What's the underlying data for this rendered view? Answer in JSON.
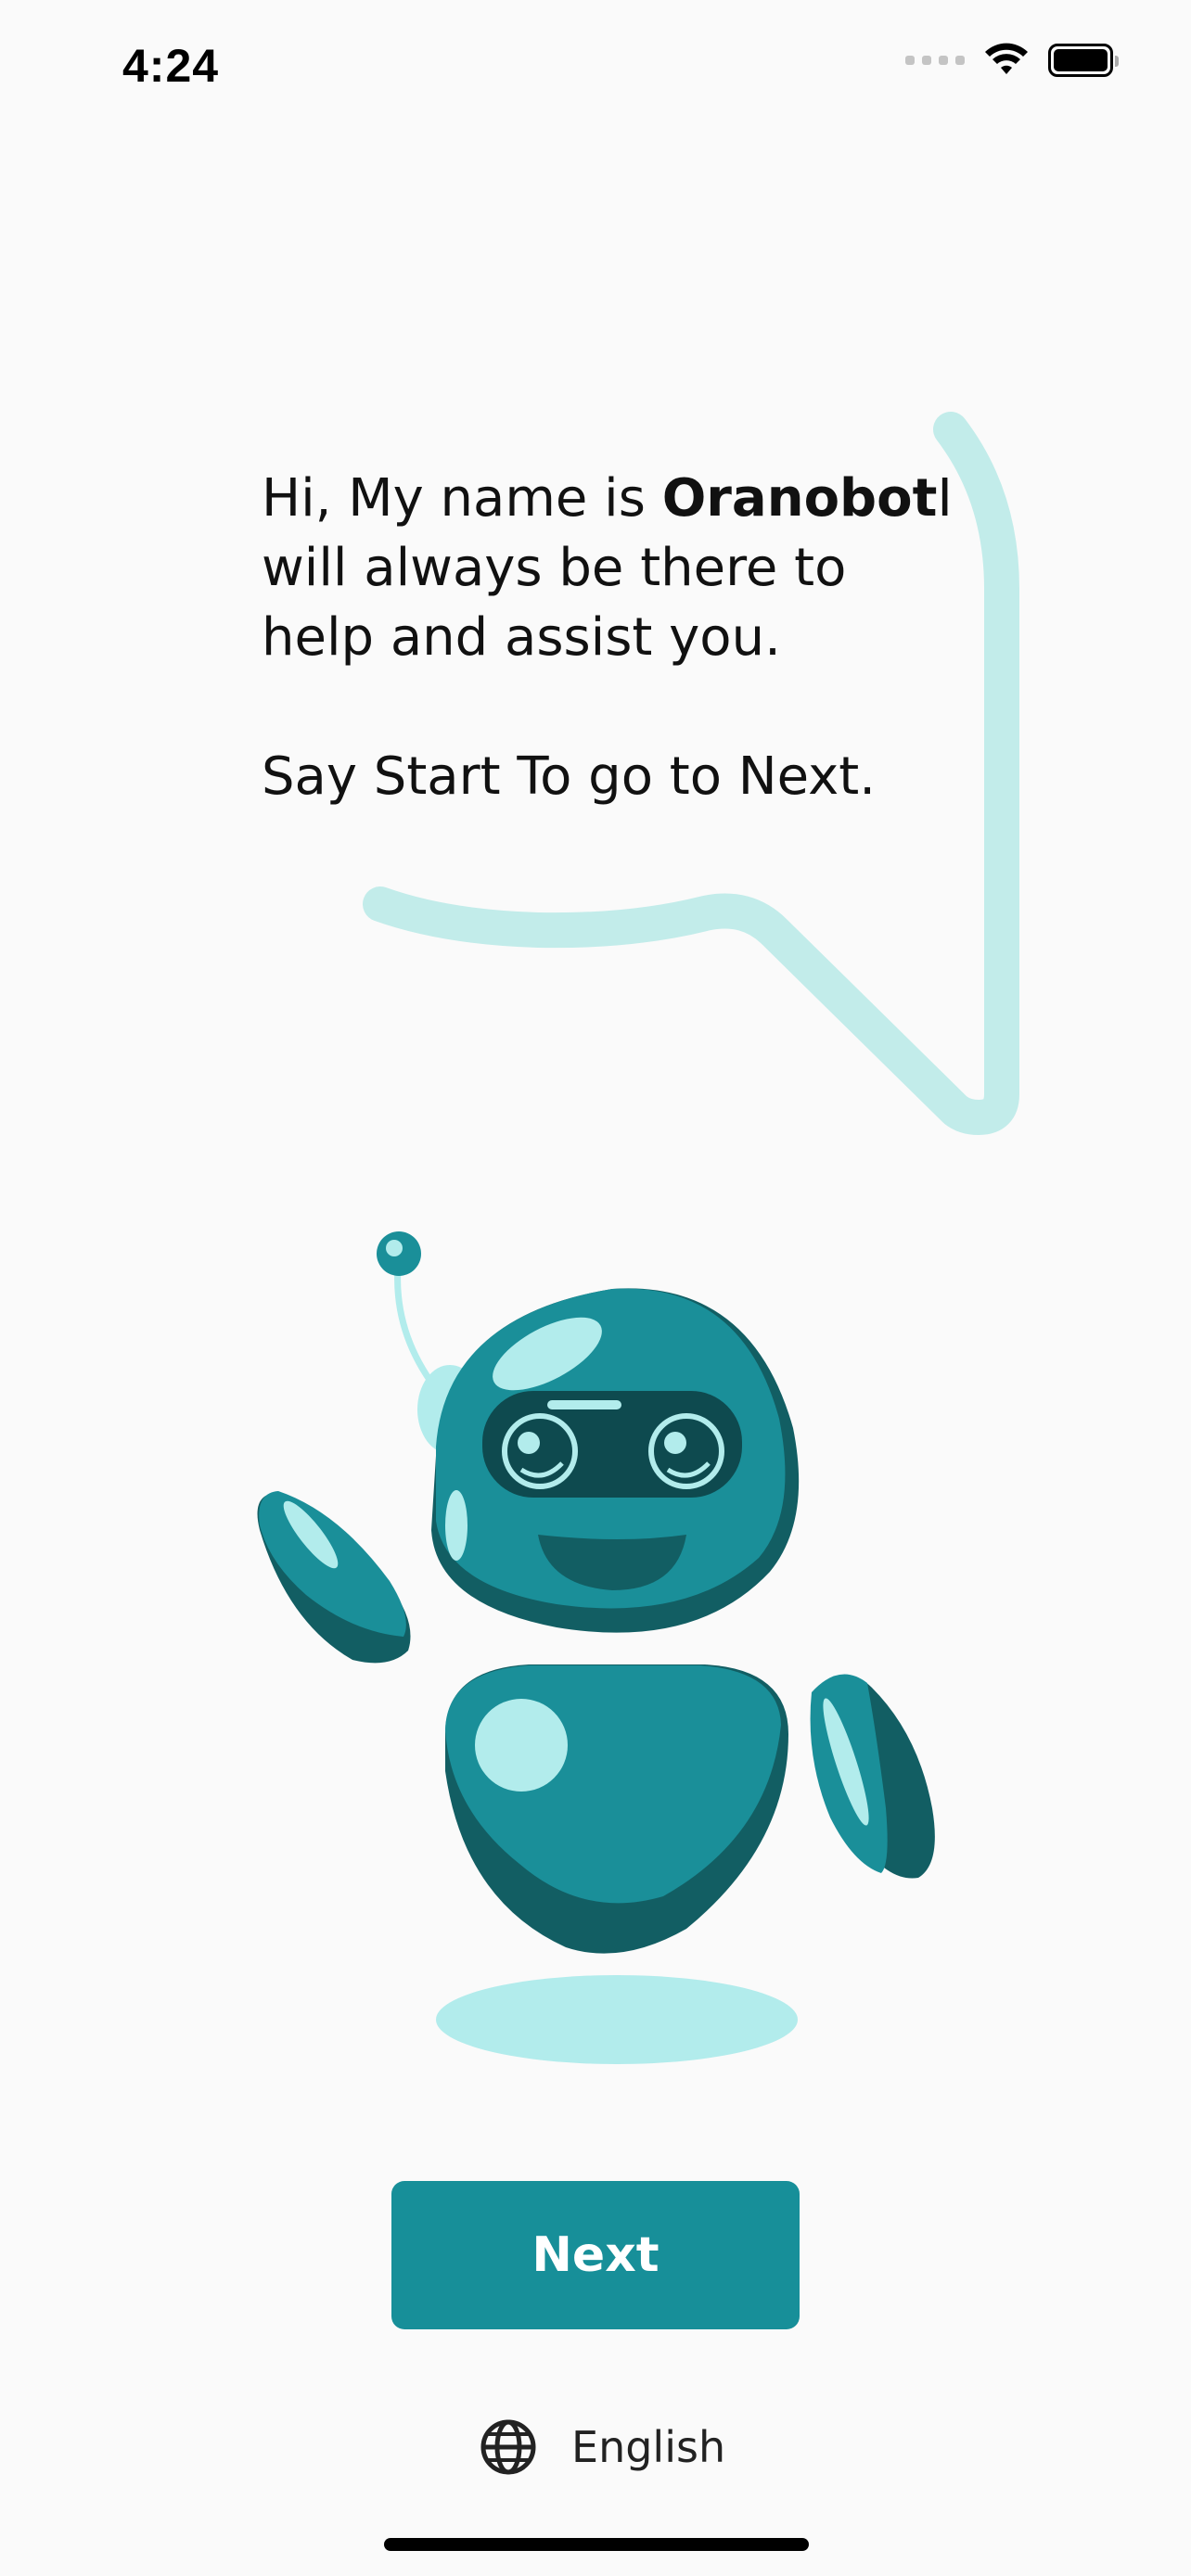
{
  "status_bar": {
    "time": "4:24"
  },
  "greeting": {
    "line1_prefix": "Hi, My name is ",
    "bot_name": "Oranobot",
    "line1_suffix": "I",
    "line2": "will always be there to",
    "line3": "help and assist you.",
    "line4": "Say Start To go to Next."
  },
  "actions": {
    "next_label": "Next"
  },
  "language": {
    "icon": "globe-icon",
    "label": "English"
  },
  "colors": {
    "accent": "#178f99",
    "bubble_stroke": "#c2ecea",
    "robot_primary": "#1a8f99",
    "robot_dark": "#125e63",
    "robot_highlight": "#b2ecec",
    "background": "#fafafa"
  }
}
